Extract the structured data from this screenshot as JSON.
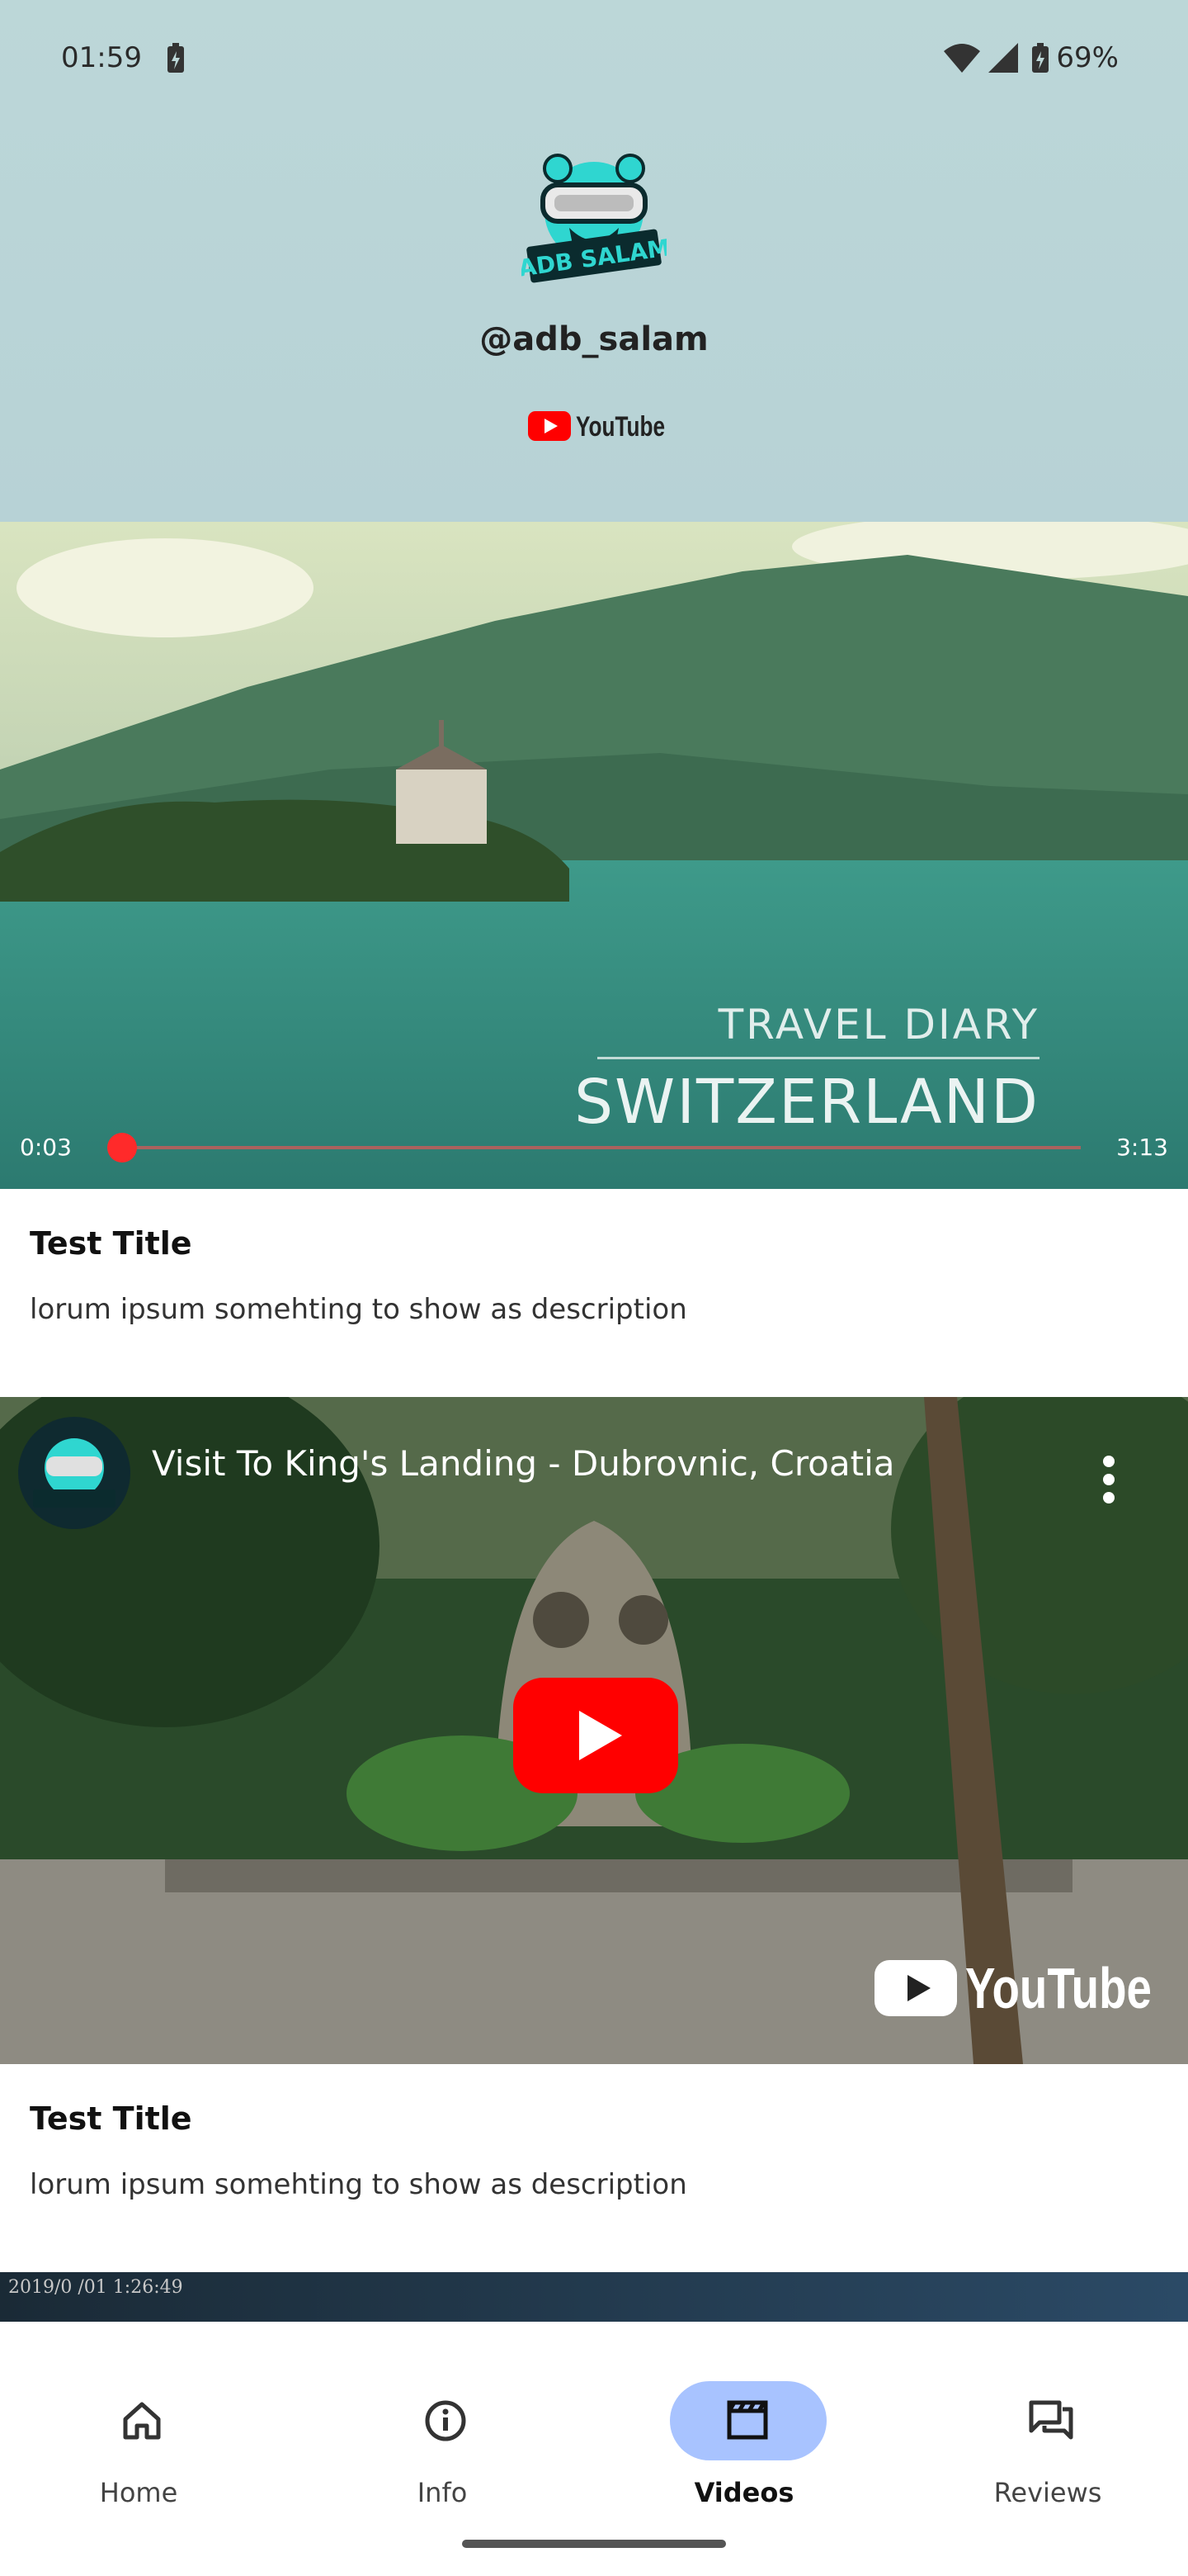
{
  "status": {
    "time": "01:59",
    "battery_pct": "69%"
  },
  "profile": {
    "handle": "@adb_salam",
    "logo_text": "ADB SALAM",
    "platform": "YouTube"
  },
  "cards": [
    {
      "video": {
        "overlay_small": "TRAVEL DIARY",
        "overlay_big": "SWITZERLAND",
        "time_current": "0:03",
        "time_total": "3:13",
        "progress": 0.016
      },
      "title": "Test Title",
      "description": "lorum ipsum somehting to show as description"
    },
    {
      "video": {
        "title": "Visit To King's Landing - Dubrovnic, Croatia",
        "watermark": "YouTube"
      },
      "title": "Test Title",
      "description": "lorum ipsum somehting to show as description"
    },
    {
      "video": {
        "stamp": "2019/0 /01 1:26:49"
      }
    }
  ],
  "nav": {
    "items": [
      {
        "label": "Home",
        "icon": "home-icon"
      },
      {
        "label": "Info",
        "icon": "info-icon"
      },
      {
        "label": "Videos",
        "icon": "videos-icon",
        "active": true
      },
      {
        "label": "Reviews",
        "icon": "reviews-icon"
      }
    ]
  },
  "colors": {
    "accent_pill": "#a8c3ff",
    "header_bg": "#bcd7d8",
    "youtube_red": "#ff0000"
  }
}
